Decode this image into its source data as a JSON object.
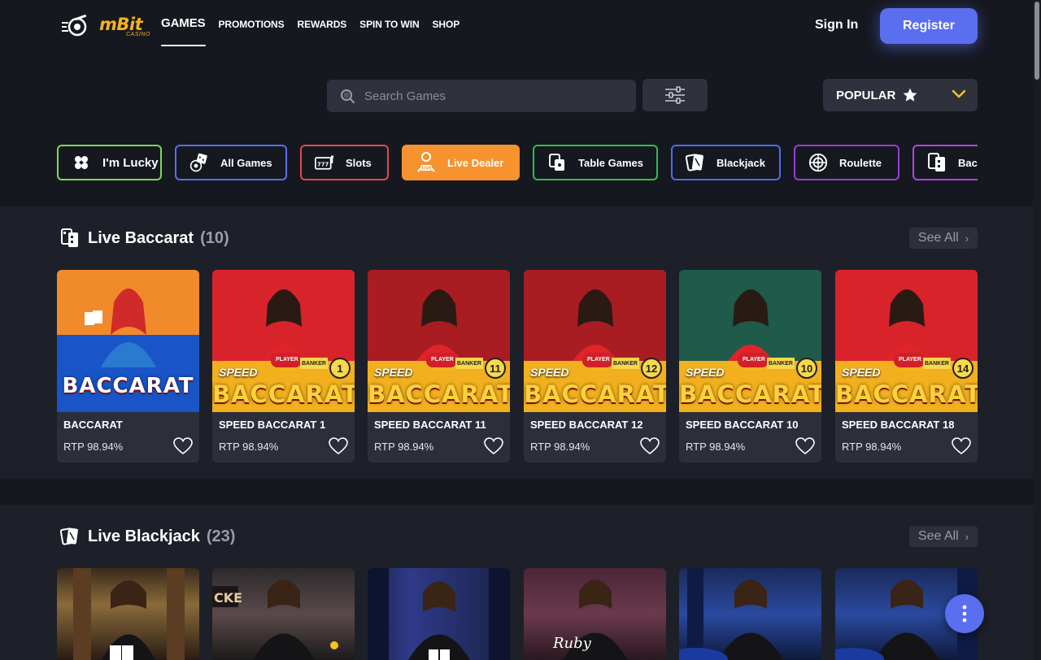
{
  "brand": {
    "name": "mBit",
    "sub": "CASINO"
  },
  "nav": [
    "GAMES",
    "PROMOTIONS",
    "REWARDS",
    "SPIN TO WIN",
    "SHOP"
  ],
  "auth": {
    "signin": "Sign In",
    "register": "Register"
  },
  "search": {
    "placeholder": "Search Games"
  },
  "sort": {
    "label": "POPULAR"
  },
  "categories": [
    {
      "label": "I'm Lucky",
      "color": "#7ed957"
    },
    {
      "label": "All Games",
      "color": "#5a6ef0"
    },
    {
      "label": "Slots",
      "color": "#e5484d"
    },
    {
      "label": "Live Dealer",
      "color": "#f7932f"
    },
    {
      "label": "Table Games",
      "color": "#2fbf4a"
    },
    {
      "label": "Blackjack",
      "color": "#4a6cf0"
    },
    {
      "label": "Roulette",
      "color": "#9b3bd6"
    },
    {
      "label": "Bac",
      "color": "#b044e6"
    }
  ],
  "sections": [
    {
      "title": "Live Baccarat",
      "count": "(10)",
      "see_all": "See All",
      "games": [
        {
          "name": "BACCARAT",
          "rtp": "RTP 98.94%",
          "thumb_label": "BACCARAT",
          "badge": ""
        },
        {
          "name": "SPEED BACCARAT 1",
          "rtp": "RTP 98.94%",
          "thumb_label": "BACCARAT",
          "badge": "1"
        },
        {
          "name": "SPEED BACCARAT 11",
          "rtp": "RTP 98.94%",
          "thumb_label": "BACCARAT",
          "badge": "11"
        },
        {
          "name": "SPEED BACCARAT 12",
          "rtp": "RTP 98.94%",
          "thumb_label": "BACCARAT",
          "badge": "12"
        },
        {
          "name": "SPEED BACCARAT 10",
          "rtp": "RTP 98.94%",
          "thumb_label": "BACCARAT",
          "badge": "10"
        },
        {
          "name": "SPEED BACCARAT 18",
          "rtp": "RTP 98.94%",
          "thumb_label": "BACCARAT",
          "badge": "14"
        }
      ]
    },
    {
      "title": "Live Blackjack",
      "count": "(23)",
      "see_all": "See All"
    }
  ],
  "thumb_text": {
    "speed": "SPEED",
    "player": "PLAYER",
    "banker": "BANKER",
    "ruby": "Ruby"
  }
}
